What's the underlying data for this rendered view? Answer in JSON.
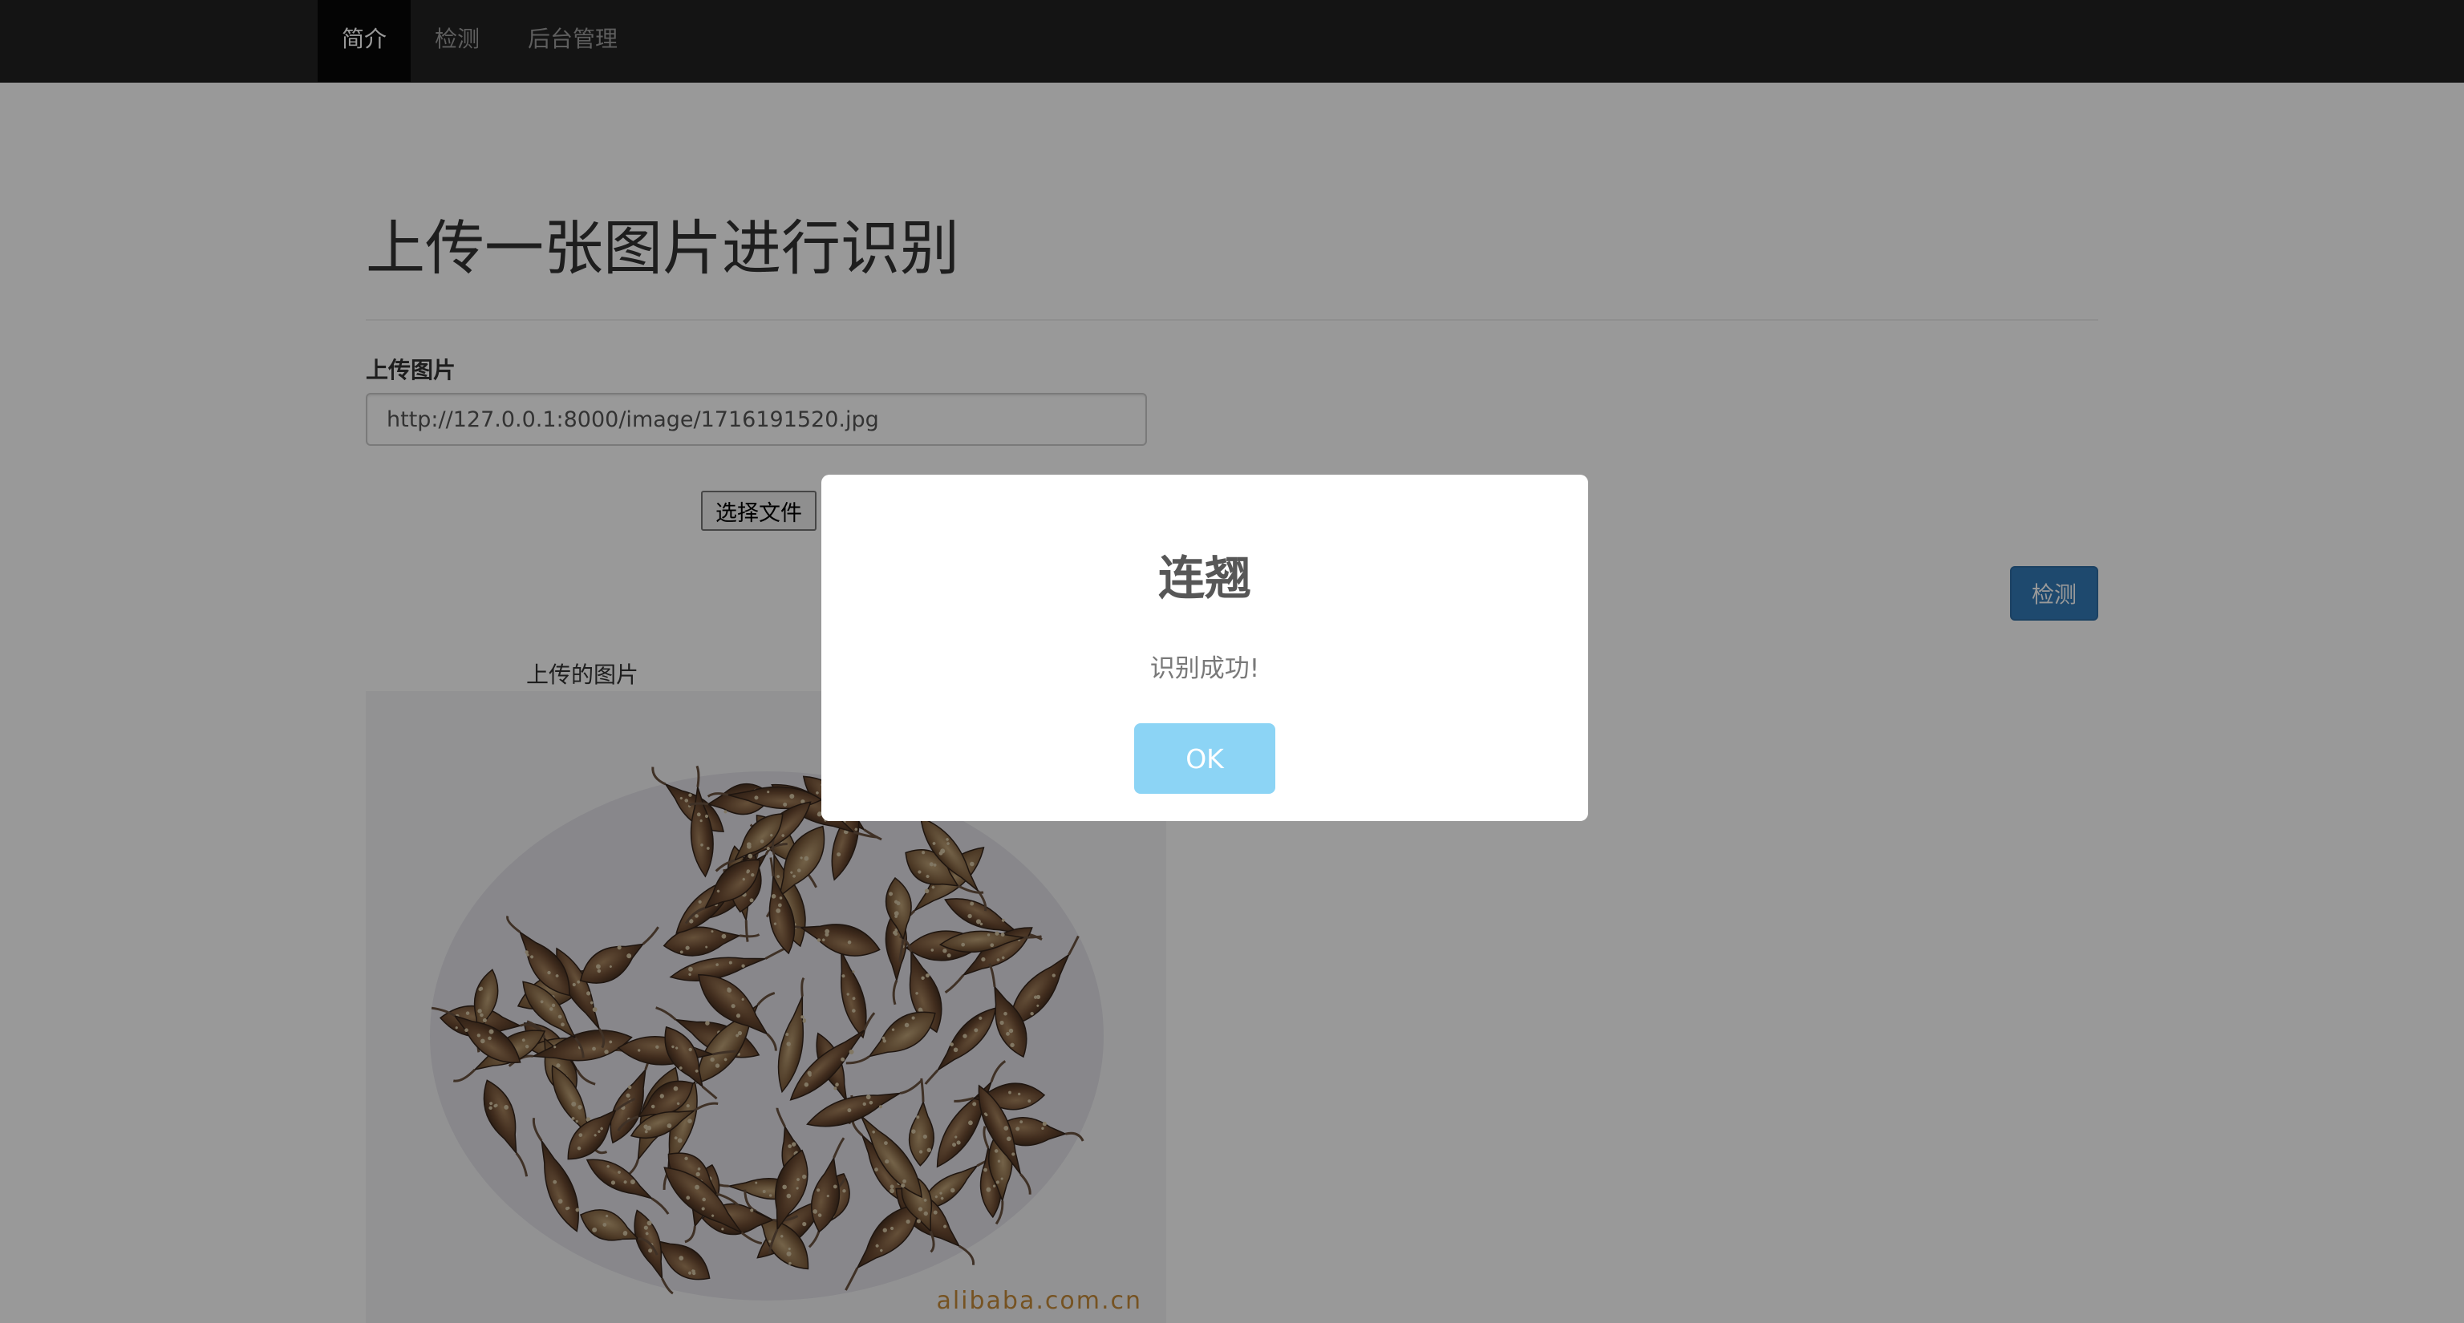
{
  "nav": {
    "items": [
      {
        "label": "简介",
        "active": true
      },
      {
        "label": "检测",
        "active": false
      },
      {
        "label": "后台管理",
        "active": false
      }
    ]
  },
  "main": {
    "title": "上传一张图片进行识别",
    "upload_label": "上传图片",
    "url_value": "http://127.0.0.1:8000/image/1716191520.jpg",
    "file_button_label": "选择文件",
    "detect_button_label": "检测",
    "image_caption": "上传的图片",
    "image_watermark": "alibaba.com.cn"
  },
  "modal": {
    "title": "连翘",
    "text": "识别成功!",
    "ok_label": "OK"
  },
  "colors": {
    "navbar": "#222222",
    "primary": "#337ab7",
    "modal_ok": "#8cd4f5",
    "overlay": "rgba(0,0,0,0.4)"
  }
}
